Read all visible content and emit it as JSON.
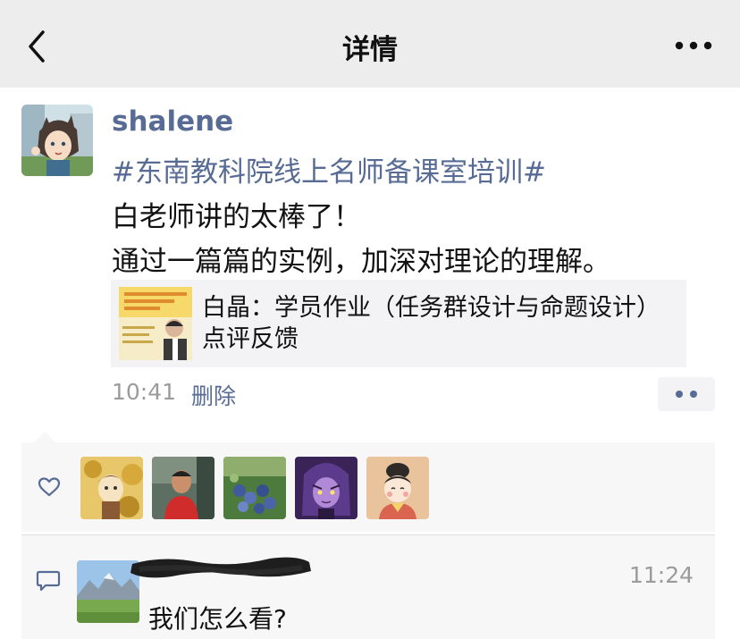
{
  "navbar": {
    "title": "详情",
    "back_icon": "chevron-left-icon",
    "more_icon": "more-dots-icon"
  },
  "post": {
    "username": "shalene",
    "hashtag": "#东南教科院线上名师备课室培训#",
    "text_lines": [
      "白老师讲的太棒了！",
      "通过一篇篇的实例，加深对理论的理解。"
    ],
    "link_card": {
      "title": "白晶：学员作业（任务群设计与命题设计）点评反馈"
    },
    "time": "10:41",
    "delete_label": "删除"
  },
  "likes": {
    "icon": "heart-outline-icon",
    "count_shown": 5
  },
  "comment": {
    "icon": "comment-bubble-icon",
    "time": "11:24",
    "text": "我们怎么看?"
  },
  "colors": {
    "link_blue": "#576b95",
    "nav_bg": "#ededed",
    "panel_bg": "#f7f7f7",
    "card_bg": "#f3f3f5",
    "meta_gray": "#9b9b9b"
  }
}
